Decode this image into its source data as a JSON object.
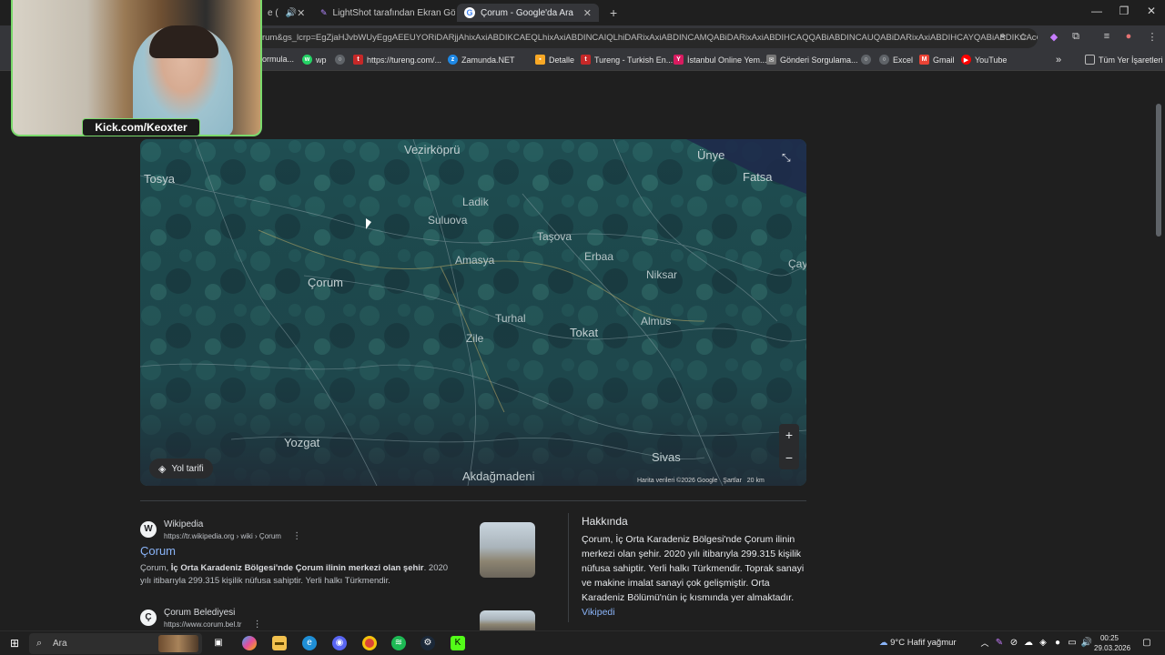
{
  "tabs": [
    {
      "label": "e (",
      "audio_icon": "speaker-icon",
      "active": false
    },
    {
      "label": "LightShot tarafından Ekran Gör",
      "active": false
    },
    {
      "label": "Çorum - Google'da Ara",
      "active": true
    }
  ],
  "address": {
    "url": "rum&gs_lcrp=EgZjaHJvbWUyEggAEEUYORiDARjjAhixAxiABDIKCAEQLhixAxiABDINCAIQLhiDARixAxiABDINCAMQABiDARixAxiABDIHCAQQABiABDINCAUQABiDARixAxiABDIHCAYQABiABDIKCAcQ"
  },
  "bookmarks": [
    {
      "label": "ormula...",
      "color": "#5f6368"
    },
    {
      "label": "wp",
      "color": "#25d366"
    },
    {
      "label": "",
      "color": "#5f6368"
    },
    {
      "label": "https://tureng.com/...",
      "color": "#c62828"
    },
    {
      "label": "Zamunda.NET",
      "color": "#1e88e5"
    },
    {
      "label": "Detalle",
      "color": "#f9a825"
    },
    {
      "label": "Tureng - Turkish En...",
      "color": "#c62828"
    },
    {
      "label": "İstanbul Online Yem...",
      "color": "#d81b60"
    },
    {
      "label": "Gönderi Sorgulama...",
      "color": "#757575"
    },
    {
      "label": "",
      "color": "#5f6368"
    },
    {
      "label": "Excel",
      "color": "#5f6368"
    },
    {
      "label": "Gmail",
      "color": "#ea4335"
    },
    {
      "label": "YouTube",
      "color": "#ff0000"
    }
  ],
  "bookmarks_more": "»",
  "bookmarks_all": "Tüm Yer İşaretleri",
  "map": {
    "cities": [
      {
        "name": "Tosya",
        "size": "big"
      },
      {
        "name": "Vezirköprü",
        "size": "big"
      },
      {
        "name": "Ünye",
        "size": "big"
      },
      {
        "name": "Fatsa",
        "size": "big"
      },
      {
        "name": "Ladik",
        "size": "normal"
      },
      {
        "name": "Suluova",
        "size": "normal"
      },
      {
        "name": "Taşova",
        "size": "normal"
      },
      {
        "name": "Amasya",
        "size": "normal"
      },
      {
        "name": "Erbaa",
        "size": "normal"
      },
      {
        "name": "Niksar",
        "size": "normal"
      },
      {
        "name": "Çorum",
        "size": "big"
      },
      {
        "name": "Turhal",
        "size": "normal"
      },
      {
        "name": "Zile",
        "size": "normal"
      },
      {
        "name": "Tokat",
        "size": "big"
      },
      {
        "name": "Almus",
        "size": "normal"
      },
      {
        "name": "Yozgat",
        "size": "big"
      },
      {
        "name": "Sivas",
        "size": "big"
      },
      {
        "name": "Akdağmadeni",
        "size": "big"
      },
      {
        "name": "Çay",
        "size": "normal"
      }
    ],
    "directions_label": "Yol tarifi",
    "zoom_in": "+",
    "zoom_out": "−",
    "attribution": "Harita verileri ©2026 Google",
    "terms": "Şartlar",
    "scale": "20 km"
  },
  "results": [
    {
      "source": "Wikipedia",
      "url": "https://tr.wikipedia.org › wiki › Çorum",
      "title": "Çorum",
      "snippet_bold_prefix": "Çorum, ",
      "snippet_bold": "İç Orta Karadeniz Bölgesi'nde Çorum ilinin merkezi olan şehir",
      "snippet_rest": ". 2020 yılı itibarıyla 299.315 kişilik nüfusa sahiptir. Yerli halkı Türkmendir.",
      "favicon": "W"
    },
    {
      "source": "Çorum Belediyesi",
      "url": "https://www.corum.bel.tr",
      "favicon": "Ç"
    }
  ],
  "knowledge_panel": {
    "title": "Hakkında",
    "body": "Çorum, İç Orta Karadeniz Bölgesi'nde Çorum ilinin merkezi olan şehir. 2020 yılı itibarıyla 299.315 kişilik nüfusa sahiptir. Yerli halkı Türkmendir. Toprak sanayi ve makine imalat sanayi çok gelişmiştir. Orta Karadeniz Bölümü'nün iç kısmında yer almaktadır.",
    "link": "Vikipedi"
  },
  "webcam": {
    "label": "Kick.com/Keoxter"
  },
  "taskbar": {
    "search_placeholder": "Ara",
    "weather": "9°C  Hafif yağmur",
    "time": "00:25",
    "date": "29.03.2026"
  }
}
